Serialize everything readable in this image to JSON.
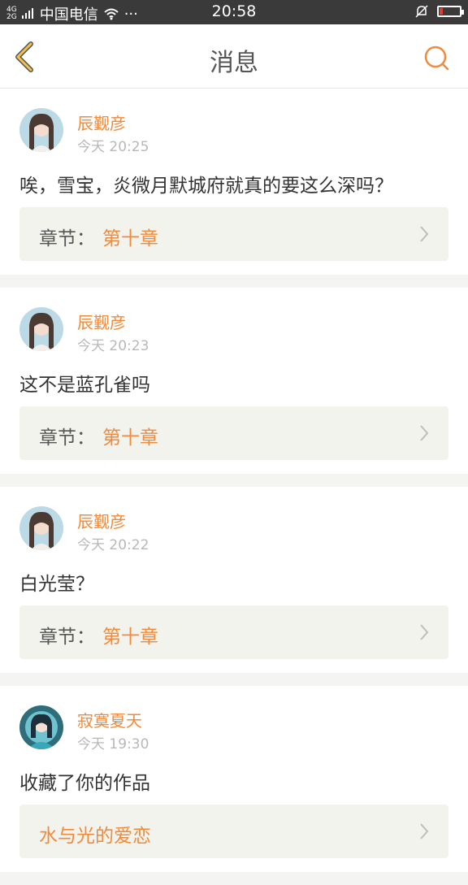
{
  "status_bar": {
    "network": "4G\n2G",
    "carrier": "中国电信",
    "more": "···",
    "time": "20:58"
  },
  "header": {
    "title": "消息"
  },
  "messages": [
    {
      "username": "辰觐彦",
      "time": "今天 20:25",
      "content": "唉，雪宝，炎微月默城府就真的要这么深吗？",
      "chapter_label": "章节：",
      "chapter_value": "第十章"
    },
    {
      "username": "辰觐彦",
      "time": "今天 20:23",
      "content": "这不是蓝孔雀吗",
      "chapter_label": "章节：",
      "chapter_value": "第十章"
    },
    {
      "username": "辰觐彦",
      "time": "今天 20:22",
      "content": "白光莹？",
      "chapter_label": "章节：",
      "chapter_value": "第十章"
    },
    {
      "username": "寂寞夏天",
      "time": "今天 19:30",
      "content": "收藏了你的作品",
      "chapter_label": "",
      "chapter_value": "水与光的爱恋"
    }
  ],
  "colors": {
    "accent": "#f08a3c",
    "back_arrow": "#f2c14e",
    "chapter_bg": "#f3f3ee",
    "status_bar": "#3a3a3a",
    "battery_low": "#e53935"
  },
  "icons": {
    "back": "chevron-left-icon",
    "search": "search-icon",
    "wifi": "wifi-icon",
    "mute": "mute-bell-icon",
    "battery": "battery-icon",
    "chapter_arrow": "chevron-right-icon"
  }
}
